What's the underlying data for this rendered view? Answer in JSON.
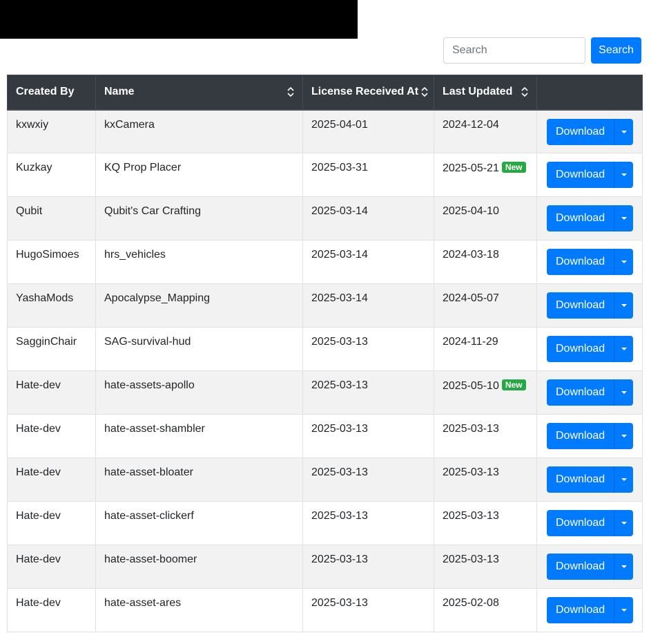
{
  "search": {
    "placeholder": "Search",
    "button_label": "Search"
  },
  "table": {
    "headers": {
      "created_by": "Created By",
      "name": "Name",
      "license_received_at": "License Received At",
      "last_updated": "Last Updated"
    },
    "badge_label": "New",
    "download_label": "Download",
    "rows": [
      {
        "created_by": "kxwxiy",
        "name": "kxCamera",
        "license_received_at": "2025-04-01",
        "last_updated": "2024-12-04",
        "is_new": false
      },
      {
        "created_by": "Kuzkay",
        "name": "KQ Prop Placer",
        "license_received_at": "2025-03-31",
        "last_updated": "2025-05-21",
        "is_new": true
      },
      {
        "created_by": "Qubit",
        "name": "Qubit's Car Crafting",
        "license_received_at": "2025-03-14",
        "last_updated": "2025-04-10",
        "is_new": false
      },
      {
        "created_by": "HugoSimoes",
        "name": "hrs_vehicles",
        "license_received_at": "2025-03-14",
        "last_updated": "2024-03-18",
        "is_new": false
      },
      {
        "created_by": "YashaMods",
        "name": "Apocalypse_Mapping",
        "license_received_at": "2025-03-14",
        "last_updated": "2024-05-07",
        "is_new": false
      },
      {
        "created_by": "SagginChair",
        "name": "SAG-survival-hud",
        "license_received_at": "2025-03-13",
        "last_updated": "2024-11-29",
        "is_new": false
      },
      {
        "created_by": "Hate-dev",
        "name": "hate-assets-apollo",
        "license_received_at": "2025-03-13",
        "last_updated": "2025-05-10",
        "is_new": true
      },
      {
        "created_by": "Hate-dev",
        "name": "hate-asset-shambler",
        "license_received_at": "2025-03-13",
        "last_updated": "2025-03-13",
        "is_new": false
      },
      {
        "created_by": "Hate-dev",
        "name": "hate-asset-bloater",
        "license_received_at": "2025-03-13",
        "last_updated": "2025-03-13",
        "is_new": false
      },
      {
        "created_by": "Hate-dev",
        "name": "hate-asset-clickerf",
        "license_received_at": "2025-03-13",
        "last_updated": "2025-03-13",
        "is_new": false
      },
      {
        "created_by": "Hate-dev",
        "name": "hate-asset-boomer",
        "license_received_at": "2025-03-13",
        "last_updated": "2025-03-13",
        "is_new": false
      },
      {
        "created_by": "Hate-dev",
        "name": "hate-asset-ares",
        "license_received_at": "2025-03-13",
        "last_updated": "2025-02-08",
        "is_new": false
      }
    ]
  },
  "icons": {
    "sort": "sort-icon",
    "caret": "caret-down-icon"
  },
  "colors": {
    "primary": "#007bff",
    "header_bg": "#343a40",
    "badge_success": "#28a745",
    "stripe": "#f2f2f2"
  }
}
